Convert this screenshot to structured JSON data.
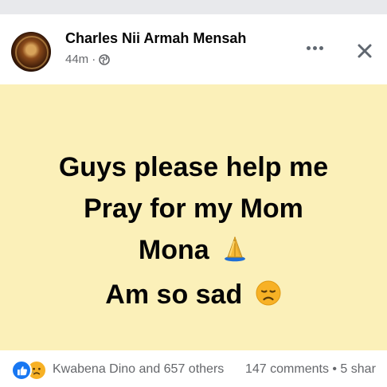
{
  "header": {
    "author_name": "Charles Nii Armah Mensah",
    "time_text": "44m",
    "separator": "·",
    "audience_icon": "globe-icon",
    "more_icon": "more-dots-icon",
    "close_icon": "close-icon"
  },
  "post": {
    "background_color": "#fbf0b9",
    "lines": [
      "Guys please help me",
      "Pray for my Mom",
      "Mona",
      "Am so sad"
    ],
    "emoji": {
      "line3": "folded-hands-icon",
      "line4": "sad-face-icon"
    }
  },
  "footer": {
    "reaction_icons": [
      "like-reaction-icon",
      "sad-reaction-icon"
    ],
    "reactors_text": "Kwabena Dino and 657 others",
    "counts_text": "147 comments • 5 shar"
  },
  "colors": {
    "brand_blue": "#1877f2",
    "meta_gray": "#65676b"
  }
}
